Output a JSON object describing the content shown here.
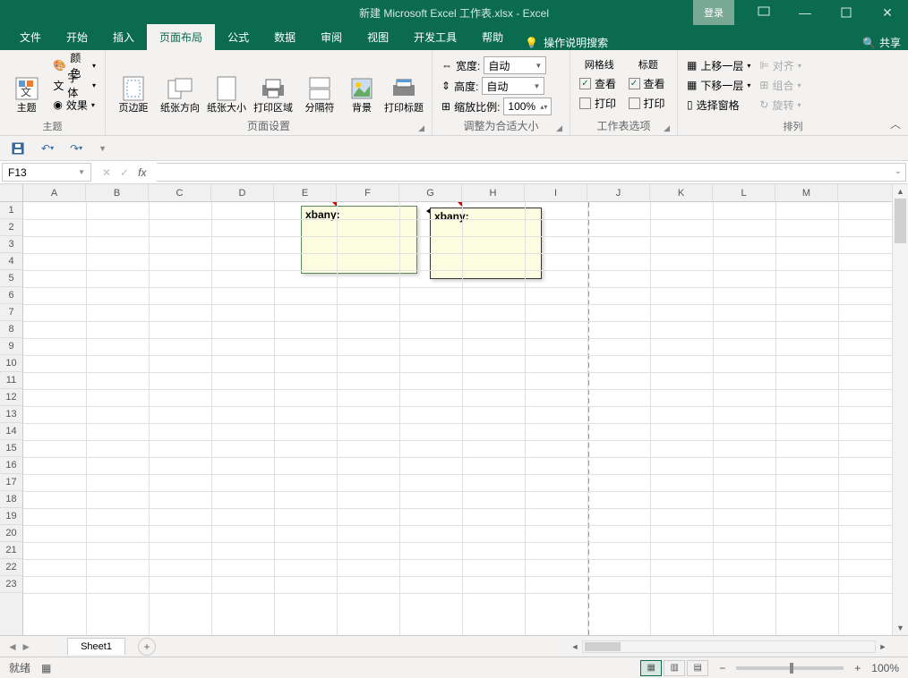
{
  "title": "新建 Microsoft Excel 工作表.xlsx  -  Excel",
  "login": "登录",
  "share": "共享",
  "tabs": [
    "文件",
    "开始",
    "插入",
    "页面布局",
    "公式",
    "数据",
    "审阅",
    "视图",
    "开发工具",
    "帮助"
  ],
  "active_tab": "页面布局",
  "tell_me": "操作说明搜索",
  "ribbon": {
    "theme": {
      "label": "主题",
      "themes": "主题",
      "colors": "颜色",
      "fonts": "字体",
      "effects": "效果"
    },
    "page_setup": {
      "label": "页面设置",
      "margins": "页边距",
      "orientation": "纸张方向",
      "size": "纸张大小",
      "print_area": "打印区域",
      "breaks": "分隔符",
      "background": "背景",
      "print_titles": "打印标题"
    },
    "scale": {
      "label": "调整为合适大小",
      "width": "宽度:",
      "height": "高度:",
      "scale": "缩放比例:",
      "auto": "自动",
      "pct": "100%"
    },
    "sheet_opts": {
      "label": "工作表选项",
      "gridlines": "网格线",
      "headings": "标题",
      "view": "查看",
      "print": "打印"
    },
    "arrange": {
      "label": "排列",
      "forward": "上移一层",
      "backward": "下移一层",
      "selection": "选择窗格",
      "align": "对齐",
      "group": "组合",
      "rotate": "旋转"
    }
  },
  "name_box": "F13",
  "columns": [
    "A",
    "B",
    "C",
    "D",
    "E",
    "F",
    "G",
    "H",
    "I",
    "J",
    "K",
    "L",
    "M"
  ],
  "rows": [
    "1",
    "2",
    "3",
    "4",
    "5",
    "6",
    "7",
    "8",
    "9",
    "10",
    "11",
    "12",
    "13",
    "14",
    "15",
    "16",
    "17",
    "18",
    "19",
    "20",
    "21",
    "22",
    "23"
  ],
  "comment1": "xbany:",
  "comment2": "xbany:",
  "sheet_name": "Sheet1",
  "status": "就绪",
  "zoom": "100%"
}
